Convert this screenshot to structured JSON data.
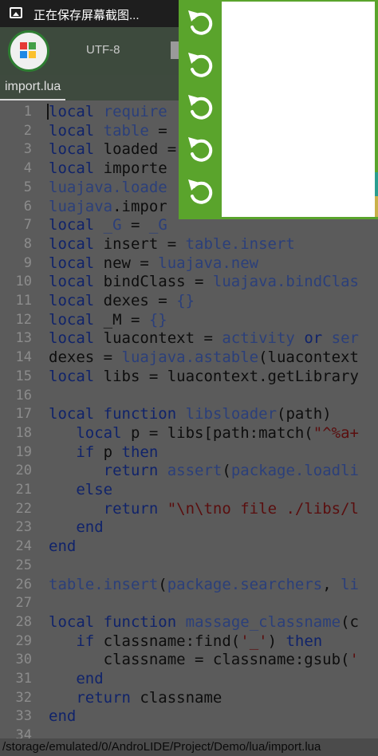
{
  "statusbar": {
    "text": "正在保存屏幕截图..."
  },
  "toolbar": {
    "encoding": "UTF-8"
  },
  "tab": {
    "label": "import.lua"
  },
  "colors": {
    "panel_green": "#5aa42c",
    "logo_red": "#e53935",
    "logo_green": "#43a047",
    "logo_blue": "#1e88e5",
    "logo_yellow": "#fbc02d"
  },
  "float_buttons": [
    {
      "icon": "undo-arrow-icon"
    },
    {
      "icon": "undo-arrow-icon"
    },
    {
      "icon": "undo-arrow-icon"
    },
    {
      "icon": "undo-arrow-icon"
    },
    {
      "icon": "undo-arrow-icon"
    }
  ],
  "code_lines": [
    {
      "n": "1",
      "tokens": [
        [
          "k",
          "local"
        ],
        [
          "t",
          " "
        ],
        [
          "f",
          "require"
        ]
      ]
    },
    {
      "n": "2",
      "tokens": [
        [
          "k",
          "local"
        ],
        [
          "t",
          " "
        ],
        [
          "f",
          "table"
        ],
        [
          "t",
          " ="
        ]
      ]
    },
    {
      "n": "3",
      "tokens": [
        [
          "k",
          "local"
        ],
        [
          "t",
          " loaded ="
        ]
      ]
    },
    {
      "n": "4",
      "tokens": [
        [
          "k",
          "local"
        ],
        [
          "t",
          " importe"
        ]
      ]
    },
    {
      "n": "5",
      "tokens": [
        [
          "f",
          "luajava.loade"
        ]
      ]
    },
    {
      "n": "6",
      "tokens": [
        [
          "f",
          "luajava"
        ],
        [
          "t",
          ".impor"
        ]
      ]
    },
    {
      "n": "7",
      "tokens": [
        [
          "k",
          "local"
        ],
        [
          "t",
          " "
        ],
        [
          "f",
          "_G"
        ],
        [
          "t",
          " = "
        ],
        [
          "f",
          "_G"
        ]
      ]
    },
    {
      "n": "8",
      "tokens": [
        [
          "k",
          "local"
        ],
        [
          "t",
          " insert = "
        ],
        [
          "f",
          "table.insert"
        ]
      ]
    },
    {
      "n": "9",
      "tokens": [
        [
          "k",
          "local"
        ],
        [
          "t",
          " new = "
        ],
        [
          "f",
          "luajava.new"
        ]
      ]
    },
    {
      "n": "10",
      "tokens": [
        [
          "k",
          "local"
        ],
        [
          "t",
          " bindClass = "
        ],
        [
          "f",
          "luajava.bindClas"
        ]
      ]
    },
    {
      "n": "11",
      "tokens": [
        [
          "k",
          "local"
        ],
        [
          "t",
          " dexes = "
        ],
        [
          "f",
          "{}"
        ]
      ]
    },
    {
      "n": "12",
      "tokens": [
        [
          "k",
          "local"
        ],
        [
          "t",
          " _M = "
        ],
        [
          "f",
          "{}"
        ]
      ]
    },
    {
      "n": "13",
      "tokens": [
        [
          "k",
          "local"
        ],
        [
          "t",
          " luacontext = "
        ],
        [
          "f",
          "activity"
        ],
        [
          "t",
          " "
        ],
        [
          "k",
          "or"
        ],
        [
          "t",
          " "
        ],
        [
          "f",
          "ser"
        ]
      ]
    },
    {
      "n": "14",
      "tokens": [
        [
          "t",
          "dexes = "
        ],
        [
          "f",
          "luajava.astable"
        ],
        [
          "t",
          "(luacontext"
        ]
      ]
    },
    {
      "n": "15",
      "tokens": [
        [
          "k",
          "local"
        ],
        [
          "t",
          " libs = luacontext."
        ],
        [
          "t",
          "getLibrary"
        ]
      ]
    },
    {
      "n": "16",
      "tokens": []
    },
    {
      "n": "17",
      "tokens": [
        [
          "k",
          "local"
        ],
        [
          "t",
          " "
        ],
        [
          "k",
          "function"
        ],
        [
          "t",
          " "
        ],
        [
          "f",
          "libsloader"
        ],
        [
          "t",
          "(path)"
        ]
      ]
    },
    {
      "n": "18",
      "tokens": [
        [
          "t",
          "   "
        ],
        [
          "k",
          "local"
        ],
        [
          "t",
          " p = libs[path:match("
        ],
        [
          "s",
          "\"^%a+"
        ]
      ]
    },
    {
      "n": "19",
      "tokens": [
        [
          "t",
          "   "
        ],
        [
          "k",
          "if"
        ],
        [
          "t",
          " p "
        ],
        [
          "k",
          "then"
        ]
      ]
    },
    {
      "n": "20",
      "tokens": [
        [
          "t",
          "      "
        ],
        [
          "k",
          "return"
        ],
        [
          "t",
          " "
        ],
        [
          "f",
          "assert"
        ],
        [
          "t",
          "("
        ],
        [
          "f",
          "package.loadli"
        ]
      ]
    },
    {
      "n": "21",
      "tokens": [
        [
          "t",
          "   "
        ],
        [
          "k",
          "else"
        ]
      ]
    },
    {
      "n": "22",
      "tokens": [
        [
          "t",
          "      "
        ],
        [
          "k",
          "return"
        ],
        [
          "t",
          " "
        ],
        [
          "s",
          "\"\\n\\tno file ./libs/l"
        ]
      ]
    },
    {
      "n": "23",
      "tokens": [
        [
          "t",
          "   "
        ],
        [
          "k",
          "end"
        ]
      ]
    },
    {
      "n": "24",
      "tokens": [
        [
          "k",
          "end"
        ]
      ]
    },
    {
      "n": "25",
      "tokens": []
    },
    {
      "n": "26",
      "tokens": [
        [
          "f",
          "table.insert"
        ],
        [
          "t",
          "("
        ],
        [
          "f",
          "package.searchers"
        ],
        [
          "t",
          ", "
        ],
        [
          "f",
          "li"
        ]
      ]
    },
    {
      "n": "27",
      "tokens": []
    },
    {
      "n": "28",
      "tokens": [
        [
          "k",
          "local"
        ],
        [
          "t",
          " "
        ],
        [
          "k",
          "function"
        ],
        [
          "t",
          " "
        ],
        [
          "f",
          "massage_classname"
        ],
        [
          "t",
          "(c"
        ]
      ]
    },
    {
      "n": "29",
      "tokens": [
        [
          "t",
          "   "
        ],
        [
          "k",
          "if"
        ],
        [
          "t",
          " classname:find("
        ],
        [
          "s",
          "'_'"
        ],
        [
          "t",
          ") "
        ],
        [
          "k",
          "then"
        ]
      ]
    },
    {
      "n": "30",
      "tokens": [
        [
          "t",
          "      classname = classname:gsub("
        ],
        [
          "s",
          "'"
        ]
      ]
    },
    {
      "n": "31",
      "tokens": [
        [
          "t",
          "   "
        ],
        [
          "k",
          "end"
        ]
      ]
    },
    {
      "n": "32",
      "tokens": [
        [
          "t",
          "   "
        ],
        [
          "k",
          "return"
        ],
        [
          "t",
          " classname"
        ]
      ]
    },
    {
      "n": "33",
      "tokens": [
        [
          "k",
          "end"
        ]
      ]
    },
    {
      "n": "34",
      "tokens": []
    }
  ],
  "pathbar": {
    "path": "/storage/emulated/0/AndroLIDE/Project/Demo/lua/import.lua"
  }
}
